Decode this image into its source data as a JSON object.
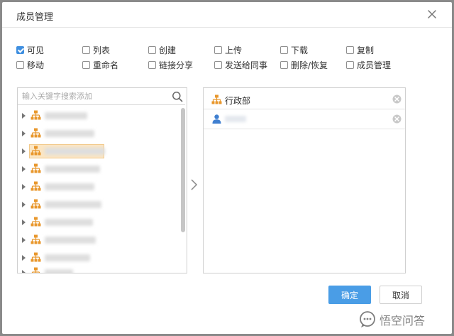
{
  "dialog": {
    "title": "成员管理"
  },
  "permissions": [
    {
      "label": "可见",
      "checked": true
    },
    {
      "label": "列表",
      "checked": false
    },
    {
      "label": "创建",
      "checked": false
    },
    {
      "label": "上传",
      "checked": false
    },
    {
      "label": "下载",
      "checked": false
    },
    {
      "label": "复制",
      "checked": false
    },
    {
      "label": "移动",
      "checked": false
    },
    {
      "label": "重命名",
      "checked": false
    },
    {
      "label": "链接分享",
      "checked": false
    },
    {
      "label": "发送给同事",
      "checked": false
    },
    {
      "label": "删除/恢复",
      "checked": false
    },
    {
      "label": "成员管理",
      "checked": false
    }
  ],
  "left_panel": {
    "search_placeholder": "输入关键字搜索添加",
    "tree_items_count_visible": 10
  },
  "right_panel": {
    "selected": [
      {
        "label": "行政部",
        "kind": "org-icon"
      },
      {
        "label": "",
        "kind": "user-icon"
      }
    ]
  },
  "buttons": {
    "confirm": "确定",
    "cancel": "取消"
  },
  "watermark": {
    "text": "悟空问答"
  },
  "colors": {
    "primary": "#4a9de6",
    "org_icon": "#e8972c",
    "user_icon": "#3f7fd0",
    "selected_bg": "#fbe6c4"
  }
}
